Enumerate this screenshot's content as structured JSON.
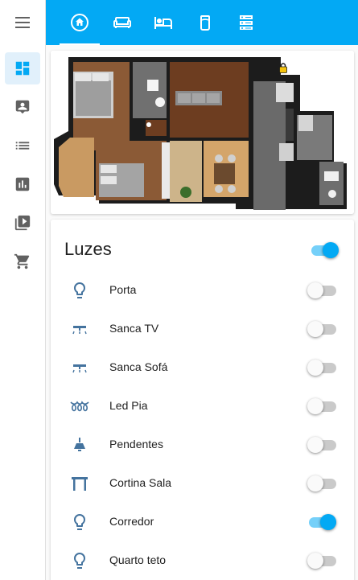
{
  "colors": {
    "accent": "#03a9f4",
    "icon": "#44739e",
    "sidebar_icon": "#616161"
  },
  "sidebar": {
    "items": [
      {
        "icon": "dashboard-icon",
        "active": true
      },
      {
        "icon": "account-box-icon"
      },
      {
        "icon": "list-icon"
      },
      {
        "icon": "chart-icon"
      },
      {
        "icon": "media-icon"
      },
      {
        "icon": "cart-icon"
      }
    ]
  },
  "topbar": {
    "tabs": [
      {
        "icon": "home-icon",
        "selected": true
      },
      {
        "icon": "sofa-icon"
      },
      {
        "icon": "bed-icon"
      },
      {
        "icon": "cylinder-icon"
      },
      {
        "icon": "server-icon"
      }
    ]
  },
  "floorplan": {
    "lock_icon": "lock-icon"
  },
  "lights": {
    "title": "Luzes",
    "master_on": true,
    "items": [
      {
        "label": "Porta",
        "icon": "bulb-icon",
        "on": false
      },
      {
        "label": "Sanca TV",
        "icon": "ceiling-light-icon",
        "on": false
      },
      {
        "label": "Sanca Sofá",
        "icon": "ceiling-light-icon",
        "on": false
      },
      {
        "label": "Led Pia",
        "icon": "string-lights-icon",
        "on": false
      },
      {
        "label": "Pendentes",
        "icon": "pendant-light-icon",
        "on": false
      },
      {
        "label": "Cortina Sala",
        "icon": "curtain-icon",
        "on": false
      },
      {
        "label": "Corredor",
        "icon": "bulb-icon",
        "on": true
      },
      {
        "label": "Quarto teto",
        "icon": "bulb-icon",
        "on": false
      }
    ]
  }
}
